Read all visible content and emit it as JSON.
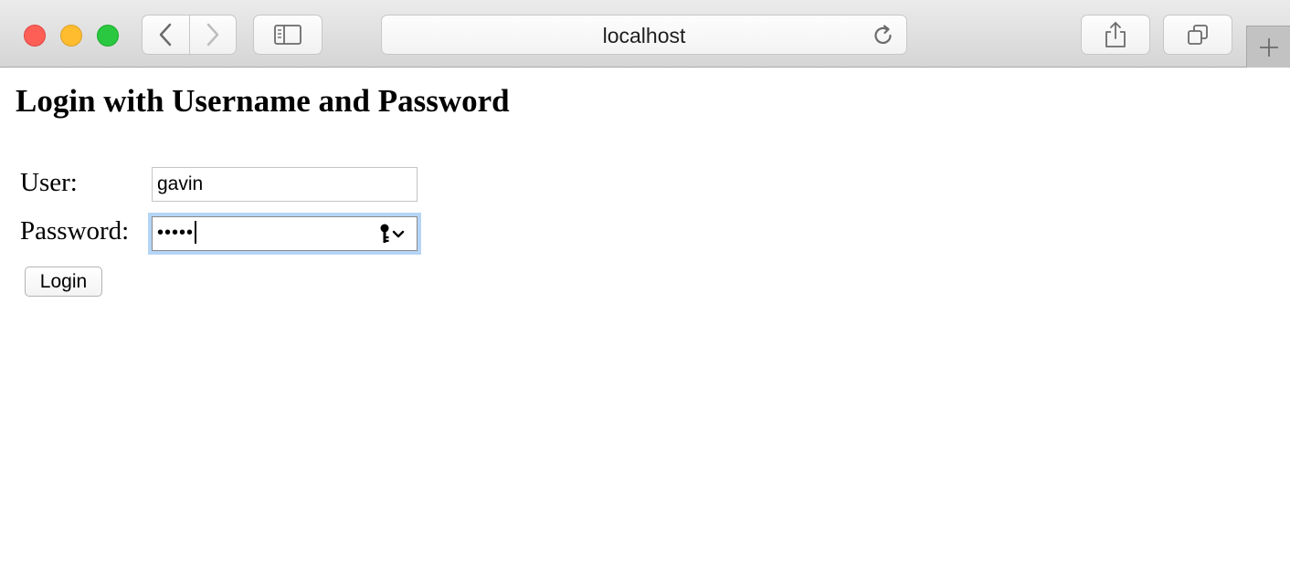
{
  "browser": {
    "address": "localhost",
    "icons": {
      "back": "chevron-left-icon",
      "forward": "chevron-right-icon",
      "sidebar": "sidebar-icon",
      "reload": "reload-icon",
      "share": "share-icon",
      "tabs": "tab-overview-icon",
      "new_tab": "plus-icon"
    },
    "traffic_colors": {
      "close": "#fd5f57",
      "minimize": "#febc2e",
      "zoom": "#29c840"
    }
  },
  "page": {
    "title": "Login with Username and Password",
    "user_label": "User:",
    "user_value": "gavin",
    "password_label": "Password:",
    "password_masked": "•••••",
    "password_icon": "key-icon",
    "submit_label": "Login",
    "focus_color": "#b5d5f6"
  }
}
